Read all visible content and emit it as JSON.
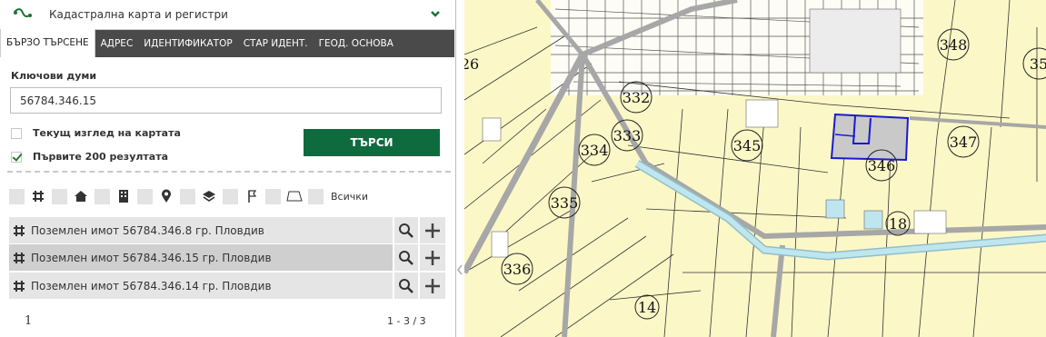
{
  "header": {
    "title": "Кадастрална карта и регистри",
    "logo_icon": "route-icon",
    "collapse_icon": "chevron-down-icon"
  },
  "tabs": [
    {
      "label": "БЪРЗО ТЪРСЕНЕ",
      "active": true
    },
    {
      "label": "АДРЕС",
      "active": false
    },
    {
      "label": "ИДЕНТИФИКАТОР",
      "active": false
    },
    {
      "label": "СТАР ИДЕНТ.",
      "active": false
    },
    {
      "label": "ГЕОД. ОСНОВА",
      "active": false
    }
  ],
  "search": {
    "keywords_label": "Ключови думи",
    "keywords_value": "56784.346.15",
    "current_view_label": "Текущ изглед на картата",
    "current_view_checked": false,
    "first200_label": "Първите 200 резултата",
    "first200_checked": true,
    "button_label": "ТЪРСИ"
  },
  "filters": {
    "icons": [
      "grid-icon",
      "home-icon",
      "building-icon",
      "location-pin-icon",
      "layers-icon",
      "flag-icon",
      "polygon-icon"
    ],
    "all_label": "Всички"
  },
  "results": [
    {
      "label": "Поземлен имот 56784.346.8 гр. Пловдив",
      "selected": false
    },
    {
      "label": "Поземлен имот 56784.346.15 гр. Пловдив",
      "selected": true
    },
    {
      "label": "Поземлен имот 56784.346.14 гр. Пловдив",
      "selected": false
    }
  ],
  "pager": {
    "page": "1",
    "count": "1 - 3 / 3"
  },
  "map": {
    "labels": [
      "26",
      "348",
      "35",
      "332",
      "333",
      "334",
      "345",
      "347",
      "346",
      "335",
      "18",
      "336",
      "14"
    ],
    "colors": {
      "parcel_fill": "#fcf7c7",
      "road": "#a7a7a7",
      "river": "#bfe6ee",
      "selection": "#1a1ad0",
      "accent": "#0e6b3d"
    }
  }
}
